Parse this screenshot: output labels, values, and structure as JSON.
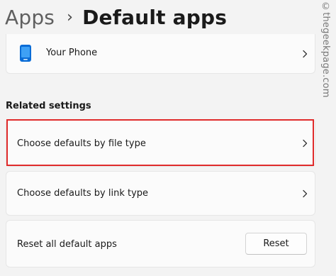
{
  "breadcrumb": {
    "parent": "Apps",
    "separator": "›",
    "current": "Default apps"
  },
  "apps": [
    {
      "label": "Your Phone",
      "icon": "phone-icon",
      "icon_color": "#0a6cd6"
    }
  ],
  "related_settings": {
    "title": "Related settings",
    "file_type_label": "Choose defaults by file type",
    "link_type_label": "Choose defaults by link type",
    "reset_label": "Reset all default apps",
    "reset_button": "Reset"
  },
  "watermark": "©thegeekpage.com",
  "colors": {
    "highlight": "#e02b2b",
    "background": "#f3f3f3",
    "card": "#fbfbfb"
  }
}
